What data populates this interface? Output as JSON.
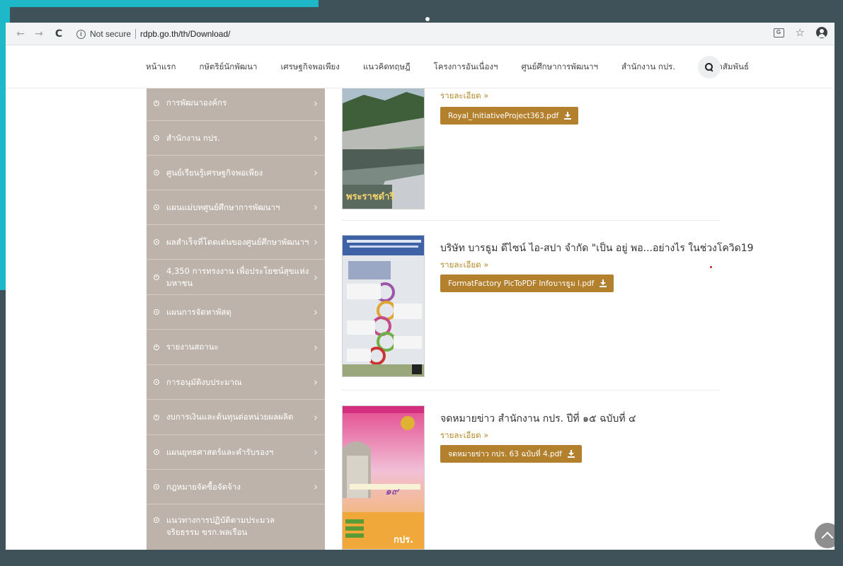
{
  "browser": {
    "security_label": "Not secure",
    "url": "rdpb.go.th/th/Download/"
  },
  "site_nav": {
    "items": [
      "หน้าแรก",
      "กษัตริย์นักพัฒนา",
      "เศรษฐกิจพอเพียง",
      "แนวคิดทฤษฎี",
      "โครงการอันเนื่องฯ",
      "ศูนย์ศึกษาการพัฒนาฯ",
      "สำนักงาน กปร.",
      "ประชาสัมพันธ์"
    ]
  },
  "sidebar": {
    "items": [
      "การพัฒนาองค์กร",
      "สำนักงาน กปร.",
      "ศูนย์เรียนรู้เศรษฐกิจพอเพียง",
      "แผนแม่บทศูนย์ศึกษาการพัฒนาฯ",
      "ผลสำเร็จที่โดดเด่นของศูนย์ศึกษาพัฒนาฯ",
      "4,350 การทรงงาน เพื่อประโยชน์สุขแห่งมหาชน",
      "แผนการจัดหาพัสดุ",
      "รายงานสถานะ",
      "การอนุมัติงบประมาณ",
      "งบการเงินและต้นทุนต่อหน่วยผลผลิต",
      "แผนยุทธศาสตร์และคำรับรองฯ",
      "กฎหมายจัดซื้อจัดจ้าง",
      "แนวทางการปฏิบัติตามประมวลจริยธรรม ขรก.พลเรือน"
    ]
  },
  "posts": [
    {
      "more_label": "รายละเอียด »",
      "file": "Royal_InitiativeProject363.pdf",
      "thumb_caption": "พระราชดำริ"
    },
    {
      "title": "บริษัท บารธูม ดีไซน์ ไอ-สปา จำกัด \"เป็น อยู่ พอ...อย่างไร ในช่วงโควิด19",
      "more_label": "รายละเอียด »",
      "file": "FormatFactory PicToPDF Infoบารธูม l.pdf"
    },
    {
      "title": "จดหมายข่าว สำนักงาน กปร. ปีที่ ๑๕ ฉบับที่ ๔",
      "more_label": "รายละเอียด »",
      "file": "จดหมายข่าว กปร. 63 ฉบับที่ 4.pdf",
      "thumb_caption": "กปร."
    }
  ],
  "colors": {
    "frame": "#3f525a",
    "accent": "#1fb8c8",
    "sidebar": "#bdb3aa",
    "button": "#b3802e",
    "link": "#b58a2c"
  }
}
